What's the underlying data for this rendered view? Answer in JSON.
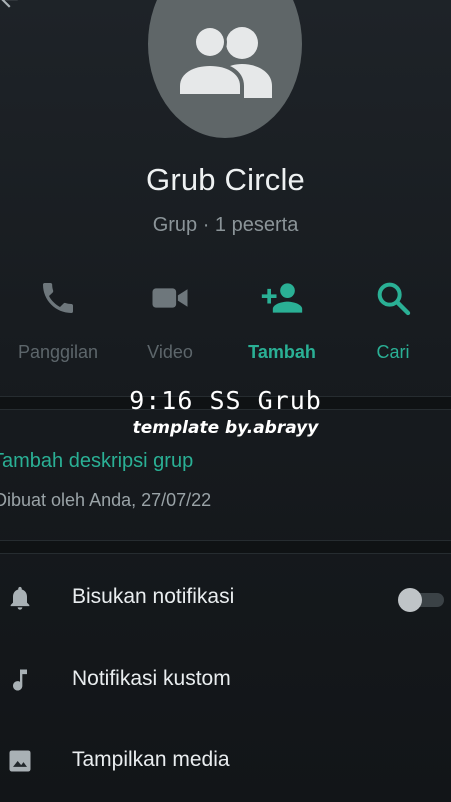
{
  "group": {
    "name": "Grub Circle",
    "subtitle": "Grup · 1 peserta"
  },
  "actions": [
    {
      "label": "Panggilan",
      "icon": "phone-icon"
    },
    {
      "label": "Video",
      "icon": "video-camera-icon"
    },
    {
      "label": "Tambah",
      "icon": "add-person-icon"
    },
    {
      "label": "Cari",
      "icon": "search-icon"
    }
  ],
  "overlay": {
    "title": "9:16 SS Grub",
    "subtitle": "template by.abrayy"
  },
  "description": {
    "add_link": "Tambah deskripsi grup",
    "created_by": "Dibuat oleh Anda, 27/07/22"
  },
  "settings": [
    {
      "label": "Bisukan notifikasi",
      "icon": "bell-icon"
    },
    {
      "label": "Notifikasi kustom",
      "icon": "music-note-icon"
    },
    {
      "label": "Tampilkan media",
      "icon": "image-icon"
    }
  ],
  "colors": {
    "accent": "#2ab095",
    "background": "#171b1f",
    "avatar": "#5f6668"
  }
}
